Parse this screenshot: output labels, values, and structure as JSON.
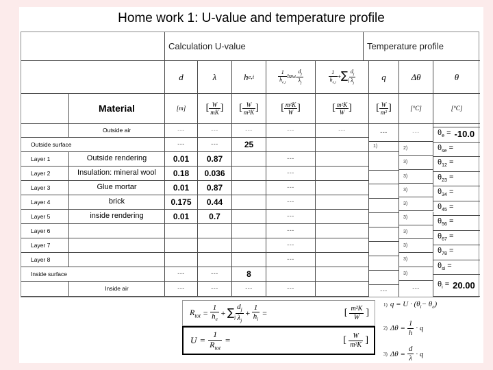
{
  "slide": {
    "title": "Home work 1: U-value and temperature profile",
    "background_color": "#fcebeb",
    "page_color": "#ffffff"
  },
  "table": {
    "group_headers": {
      "blank": "",
      "calculation": "Calculation U-value",
      "temperature": "Temperature profile"
    },
    "symbol_row": {
      "d": "d",
      "lambda": "λ",
      "h": "h",
      "h_sub": "e,i",
      "r_layer_1": "1",
      "r_layer_bzw": "bzw.",
      "r_layer_d": "d",
      "r_layer_lam": "λ",
      "r_sum_1": "1",
      "q": "q",
      "delta_theta": "Δθ",
      "theta": "θ"
    },
    "unit_row": {
      "material_label": "Material",
      "d": "[m]",
      "lambda_num": "W",
      "lambda_den": "mK",
      "h_num": "W",
      "h_den": "m²K",
      "r_num": "m²K",
      "r_den": "W",
      "rsum_num": "m²K",
      "rsum_den": "W",
      "q_num": "W",
      "q_den": "m²",
      "dtheta": "[°C]",
      "theta": "[°C]"
    },
    "columns": [
      "Layer",
      "Material",
      "d",
      "lambda",
      "h",
      "R_layer",
      "R_sum",
      "q",
      "delta_theta",
      "theta"
    ],
    "rows": [
      {
        "layer": "",
        "material": "Outside air",
        "d": "---",
        "lambda": "---",
        "h": "---",
        "r_layer": "---",
        "r_sum": "---",
        "dim": true
      },
      {
        "layer": "Outside surface",
        "material": "",
        "d": "---",
        "lambda": "---",
        "h": "25",
        "r_layer": "",
        "r_sum": "",
        "dim": false,
        "h_bold": true
      },
      {
        "layer": "Layer 1",
        "material": "Outside rendering",
        "d": "0.01",
        "lambda": "0.87",
        "h": "",
        "r_layer": "---",
        "r_sum": "",
        "bold": true
      },
      {
        "layer": "Layer 2",
        "material": "Insulation: mineral wool",
        "d": "0.18",
        "lambda": "0.036",
        "h": "",
        "r_layer": "---",
        "r_sum": "",
        "bold": true
      },
      {
        "layer": "Layer 3",
        "material": "Glue mortar",
        "d": "0.01",
        "lambda": "0.87",
        "h": "",
        "r_layer": "---",
        "r_sum": "",
        "bold": true
      },
      {
        "layer": "Layer 4",
        "material": "brick",
        "d": "0.175",
        "lambda": "0.44",
        "h": "",
        "r_layer": "---",
        "r_sum": "",
        "bold": true
      },
      {
        "layer": "Layer 5",
        "material": "inside rendering",
        "d": "0.01",
        "lambda": "0.7",
        "h": "",
        "r_layer": "---",
        "r_sum": "",
        "bold": true
      },
      {
        "layer": "Layer 6",
        "material": "",
        "d": "",
        "lambda": "",
        "h": "",
        "r_layer": "---",
        "r_sum": ""
      },
      {
        "layer": "Layer  7",
        "material": "",
        "d": "",
        "lambda": "",
        "h": "",
        "r_layer": "---",
        "r_sum": ""
      },
      {
        "layer": "Layer  8",
        "material": "",
        "d": "",
        "lambda": "",
        "h": "",
        "r_layer": "---",
        "r_sum": ""
      },
      {
        "layer": "Inside surface",
        "material": "",
        "d": "---",
        "lambda": "---",
        "h": "8",
        "r_layer": "",
        "r_sum": "",
        "h_bold": true
      },
      {
        "layer": "",
        "material": "Inside air",
        "d": "---",
        "lambda": "---",
        "h": "---",
        "r_layer": "---",
        "r_sum": "",
        "dim": false
      }
    ],
    "q_column": {
      "top_dash": "---",
      "marker": "1)",
      "bottom_dash": "---"
    },
    "dtheta_column": {
      "top_dash": "---",
      "markers": [
        "2)",
        "3)",
        "3)",
        "3)",
        "3)",
        "3)",
        "3)",
        "3)",
        "3)",
        "3)"
      ],
      "bottom_dash": "---"
    },
    "theta_column": [
      {
        "symbol": "θ",
        "sub": "e",
        "eq": "=",
        "value": "-10.0"
      },
      {
        "symbol": "θ",
        "sub": "se",
        "eq": "=",
        "value": ""
      },
      {
        "symbol": "θ",
        "sub": "12",
        "eq": "=",
        "value": ""
      },
      {
        "symbol": "θ",
        "sub": "23",
        "eq": "=",
        "value": ""
      },
      {
        "symbol": "θ",
        "sub": "34",
        "eq": "=",
        "value": ""
      },
      {
        "symbol": "θ",
        "sub": "45",
        "eq": "=",
        "value": ""
      },
      {
        "symbol": "θ",
        "sub": "56",
        "eq": "=",
        "value": ""
      },
      {
        "symbol": "θ",
        "sub": "67",
        "eq": "=",
        "value": ""
      },
      {
        "symbol": "θ",
        "sub": "78",
        "eq": "=",
        "value": ""
      },
      {
        "symbol": "θ",
        "sub": "si",
        "eq": "=",
        "value": ""
      },
      {
        "symbol": "θ",
        "sub": "i",
        "eq": "=",
        "value": "20.00"
      }
    ]
  },
  "formulas": {
    "r_total": {
      "lhs": "R",
      "lhs_sub": "tot",
      "eq": "=",
      "term1_num": "1",
      "term1_den": "h",
      "term1_den_sub": "e",
      "plus1": "+",
      "sigma": "∑",
      "sigma_sub": "j",
      "term2_num": "d",
      "term2_num_sub": "j",
      "term2_den": "λ",
      "term2_den_sub": "j",
      "plus2": "+",
      "term3_num": "1",
      "term3_den": "h",
      "term3_den_sub": "i",
      "tail": "=",
      "unit_num": "m²K",
      "unit_den": "W"
    },
    "u_value": {
      "lhs": "U",
      "eq": "=",
      "num": "1",
      "den": "R",
      "den_sub": "tot",
      "tail": "=",
      "unit_num": "W",
      "unit_den": "m²K"
    },
    "right": [
      {
        "index": "1)",
        "text": "q = U · (θ",
        "sub1": "i",
        "mid": "− θ",
        "sub2": "e",
        "close": ")"
      },
      {
        "index": "2)",
        "lhs": "Δθ =",
        "num": "1",
        "den": "h",
        "tail": "· q"
      },
      {
        "index": "3)",
        "lhs": "Δθ =",
        "num": "d",
        "den": "λ",
        "tail": "· q"
      }
    ]
  }
}
